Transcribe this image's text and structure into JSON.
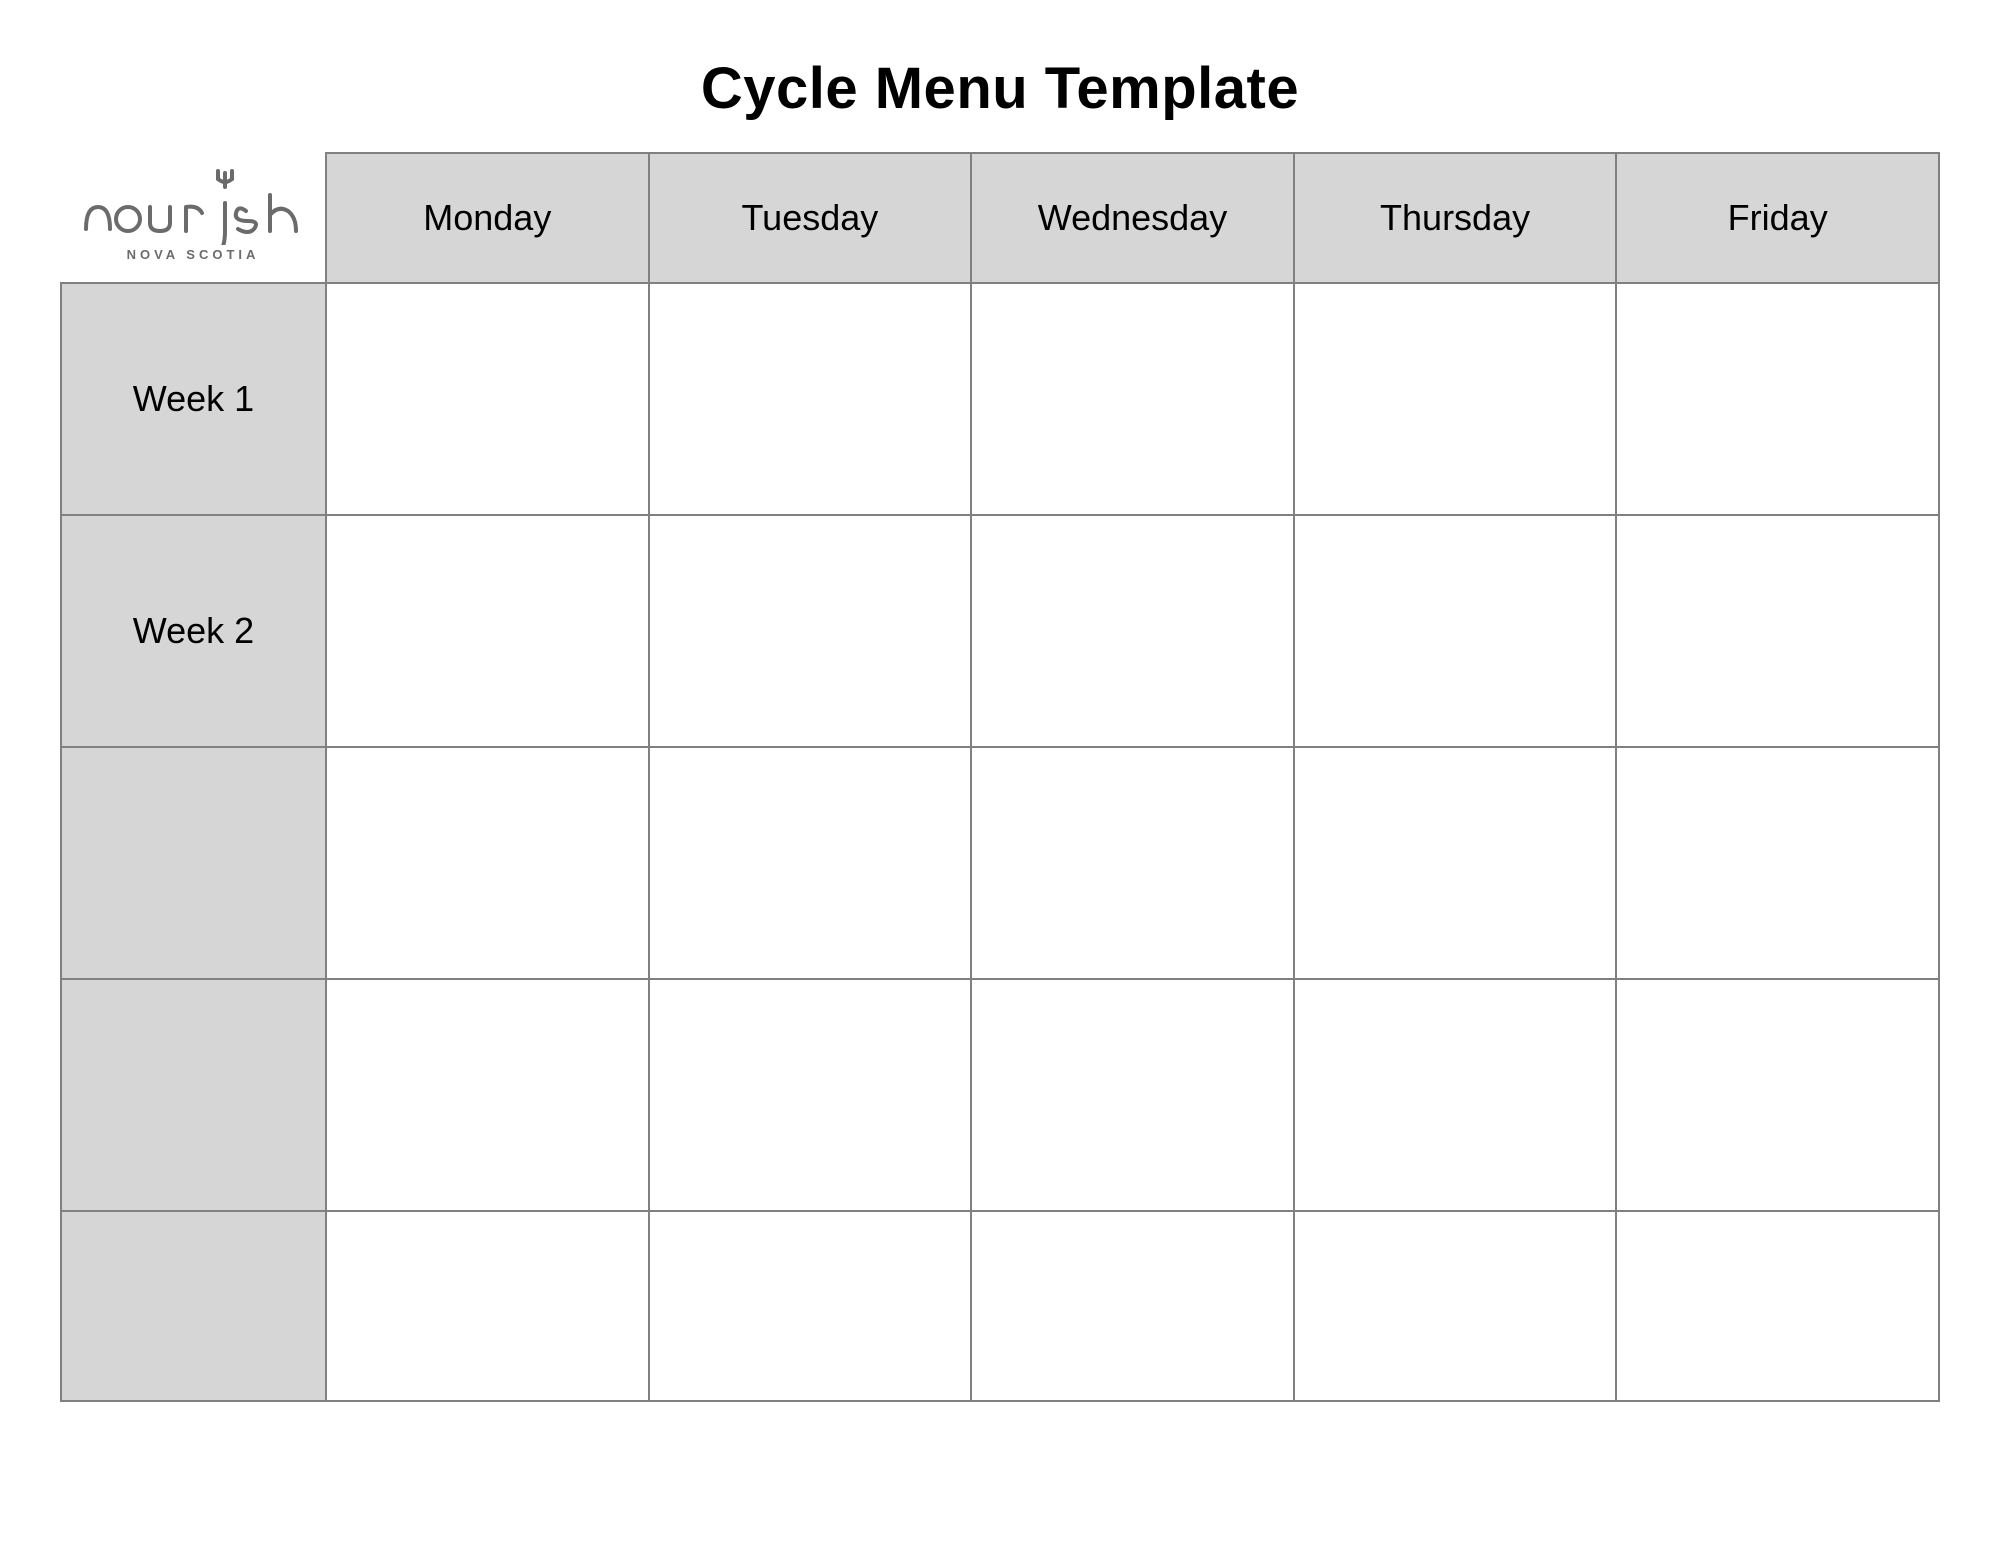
{
  "title": "Cycle Menu Template",
  "logo": {
    "word": "nourish",
    "subtext": "NOVA SCOTIA"
  },
  "days": [
    "Monday",
    "Tuesday",
    "Wednesday",
    "Thursday",
    "Friday"
  ],
  "weeks": [
    "Week 1",
    "Week 2",
    "",
    "",
    ""
  ]
}
